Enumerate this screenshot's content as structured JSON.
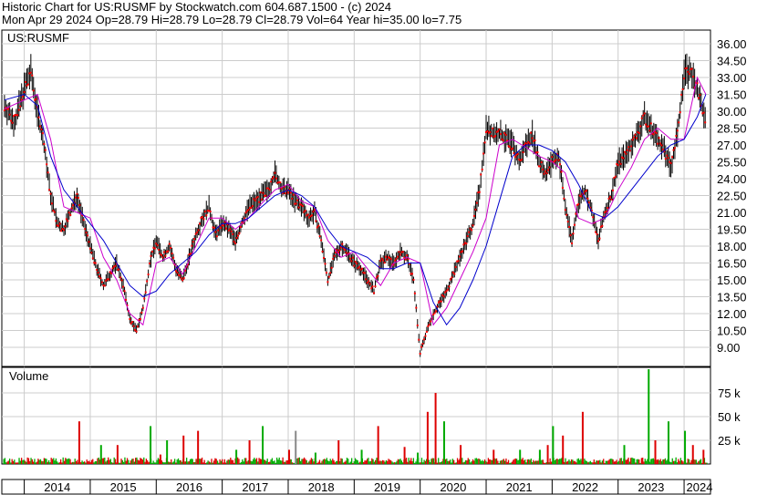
{
  "header": {
    "line1": "Historic Chart for US:RUSMF by Stockwatch.com 604.687.1500 - (c) 2024",
    "line2": "Mon Apr 29 2024   Op=28.79   Hi=28.79   Lo=28.79   Cl=28.79   Vol=64   Year hi=35.00   lo=7.75"
  },
  "colors": {
    "price_bar": "#000000",
    "close_marker": "#ff0000",
    "ma_short": "#cc00cc",
    "ma_long": "#0000cc",
    "volume_up": "#00aa00",
    "volume_down": "#dd0000",
    "volume_flat": "#888888",
    "grid": "#cccccc"
  },
  "chart_data": [
    {
      "type": "line",
      "label": "US:RUSMF",
      "ylim": [
        7.75,
        36.0
      ],
      "y_ticks": [
        "36.00",
        "34.50",
        "33.00",
        "31.50",
        "30.00",
        "28.50",
        "27.00",
        "25.50",
        "24.00",
        "22.50",
        "21.00",
        "19.50",
        "18.00",
        "16.50",
        "15.00",
        "13.50",
        "12.00",
        "10.50",
        "9.00"
      ],
      "x_ticks": [
        "2014",
        "2015",
        "2016",
        "2017",
        "2018",
        "2019",
        "2020",
        "2021",
        "2022",
        "2023",
        "2024"
      ],
      "grid": true,
      "series": [
        {
          "x": [
            2013.7,
            2013.85,
            2014.0,
            2014.1,
            2014.2,
            2014.3,
            2014.4,
            2014.5,
            2014.6,
            2014.7,
            2014.8,
            2014.9,
            2015.0,
            2015.1,
            2015.2,
            2015.3,
            2015.4,
            2015.5,
            2015.6,
            2015.7,
            2015.8,
            2015.9,
            2016.0,
            2016.1,
            2016.2,
            2016.3,
            2016.4,
            2016.5,
            2016.6,
            2016.7,
            2016.8,
            2016.9,
            2017.0,
            2017.1,
            2017.2,
            2017.3,
            2017.4,
            2017.5,
            2017.6,
            2017.7,
            2017.8,
            2017.9,
            2018.0,
            2018.1,
            2018.2,
            2018.3,
            2018.4,
            2018.5,
            2018.6,
            2018.7,
            2018.8,
            2018.9,
            2019.0,
            2019.1,
            2019.2,
            2019.3,
            2019.4,
            2019.5,
            2019.6,
            2019.7,
            2019.8,
            2019.9,
            2020.0,
            2020.1,
            2020.2,
            2020.3,
            2020.4,
            2020.5,
            2020.6,
            2020.7,
            2020.8,
            2020.9,
            2021.0,
            2021.1,
            2021.2,
            2021.3,
            2021.4,
            2021.5,
            2021.6,
            2021.7,
            2021.8,
            2021.9,
            2022.0,
            2022.1,
            2022.2,
            2022.3,
            2022.4,
            2022.5,
            2022.6,
            2022.7,
            2022.8,
            2022.9,
            2023.0,
            2023.1,
            2023.2,
            2023.3,
            2023.4,
            2023.5,
            2023.6,
            2023.7,
            2023.8,
            2023.9,
            2024.0,
            2024.1,
            2024.2,
            2024.33
          ],
          "values": [
            30.5,
            29.0,
            32.0,
            33.5,
            30.0,
            27.0,
            22.5,
            20.0,
            19.5,
            21.0,
            22.5,
            20.0,
            18.0,
            16.0,
            14.5,
            15.5,
            16.5,
            14.5,
            11.5,
            10.5,
            12.5,
            16.5,
            18.5,
            17.0,
            18.0,
            16.0,
            15.0,
            17.0,
            19.0,
            20.5,
            21.5,
            19.0,
            20.0,
            19.5,
            18.5,
            20.0,
            21.5,
            22.0,
            22.5,
            23.0,
            24.5,
            23.0,
            23.0,
            22.0,
            21.5,
            20.5,
            21.0,
            18.5,
            15.0,
            17.0,
            18.0,
            17.5,
            16.5,
            16.0,
            15.0,
            14.0,
            16.5,
            17.0,
            16.5,
            17.5,
            17.0,
            15.0,
            8.5,
            10.5,
            12.0,
            13.0,
            14.0,
            15.5,
            17.0,
            18.5,
            20.0,
            23.0,
            28.5,
            28.0,
            28.0,
            27.5,
            27.0,
            25.5,
            27.0,
            28.0,
            25.5,
            24.5,
            25.5,
            26.0,
            21.5,
            18.5,
            22.0,
            23.0,
            21.0,
            18.5,
            21.0,
            22.5,
            25.5,
            26.0,
            27.0,
            28.0,
            29.5,
            28.5,
            27.5,
            26.5,
            25.0,
            28.0,
            33.5,
            33.5,
            32.0,
            28.8
          ]
        },
        {
          "x": [
            2013.7,
            2014.0,
            2014.2,
            2014.4,
            2014.6,
            2014.8,
            2015.0,
            2015.2,
            2015.4,
            2015.6,
            2015.8,
            2016.0,
            2016.2,
            2016.4,
            2016.6,
            2016.8,
            2017.0,
            2017.2,
            2017.4,
            2017.6,
            2017.8,
            2018.0,
            2018.2,
            2018.4,
            2018.6,
            2018.8,
            2019.0,
            2019.2,
            2019.4,
            2019.6,
            2019.8,
            2020.0,
            2020.2,
            2020.4,
            2020.6,
            2020.8,
            2021.0,
            2021.2,
            2021.4,
            2021.6,
            2021.8,
            2022.0,
            2022.2,
            2022.4,
            2022.6,
            2022.8,
            2023.0,
            2023.2,
            2023.4,
            2023.6,
            2023.8,
            2024.0,
            2024.2,
            2024.33
          ],
          "values": [
            30.2,
            31.0,
            31.5,
            27.5,
            21.5,
            21.0,
            20.5,
            17.0,
            15.0,
            12.0,
            11.0,
            16.5,
            17.0,
            15.5,
            18.0,
            20.5,
            20.5,
            19.5,
            20.5,
            21.8,
            23.0,
            23.5,
            22.0,
            21.5,
            18.5,
            17.0,
            17.5,
            16.0,
            14.5,
            16.5,
            17.0,
            16.5,
            11.0,
            12.5,
            15.0,
            17.5,
            20.5,
            27.0,
            27.5,
            26.8,
            26.0,
            25.5,
            24.5,
            20.5,
            20.0,
            20.5,
            23.0,
            25.0,
            27.5,
            28.5,
            27.5,
            27.5,
            33.0,
            31.5
          ]
        },
        {
          "x": [
            2013.7,
            2014.0,
            2014.2,
            2014.4,
            2014.6,
            2014.8,
            2015.0,
            2015.2,
            2015.4,
            2015.6,
            2015.8,
            2016.0,
            2016.2,
            2016.4,
            2016.6,
            2016.8,
            2017.0,
            2017.2,
            2017.4,
            2017.6,
            2017.8,
            2018.0,
            2018.2,
            2018.4,
            2018.6,
            2018.8,
            2019.0,
            2019.2,
            2019.4,
            2019.6,
            2019.8,
            2020.0,
            2020.2,
            2020.4,
            2020.6,
            2020.8,
            2021.0,
            2021.2,
            2021.4,
            2021.6,
            2021.8,
            2022.0,
            2022.2,
            2022.4,
            2022.6,
            2022.8,
            2023.0,
            2023.2,
            2023.4,
            2023.6,
            2023.8,
            2024.0,
            2024.2,
            2024.33
          ],
          "values": [
            31.0,
            31.5,
            30.5,
            26.0,
            23.0,
            21.5,
            20.0,
            18.5,
            16.5,
            14.5,
            13.5,
            14.0,
            15.5,
            16.5,
            17.5,
            19.0,
            20.0,
            20.0,
            20.5,
            21.5,
            22.5,
            23.0,
            22.5,
            21.5,
            19.5,
            18.0,
            17.5,
            17.0,
            16.0,
            16.0,
            16.5,
            16.5,
            13.0,
            11.0,
            12.5,
            15.0,
            18.0,
            22.0,
            26.0,
            27.0,
            27.0,
            26.5,
            25.5,
            23.5,
            21.0,
            20.5,
            21.5,
            23.0,
            24.5,
            26.0,
            27.0,
            27.5,
            29.5,
            31.5
          ]
        }
      ]
    },
    {
      "type": "bar",
      "title": "Volume",
      "ylim": [
        0,
        100
      ],
      "y_ticks": [
        "75 k",
        "50 k",
        "25 k"
      ],
      "x": [
        2014.82,
        2015.15,
        2015.4,
        2015.9,
        2016.05,
        2016.15,
        2016.4,
        2016.62,
        2017.2,
        2017.4,
        2017.6,
        2018.0,
        2018.1,
        2018.4,
        2018.75,
        2019.1,
        2019.35,
        2019.75,
        2019.95,
        2020.1,
        2020.22,
        2020.35,
        2020.6,
        2021.1,
        2021.5,
        2021.8,
        2021.92,
        2022.0,
        2022.15,
        2022.45,
        2023.08,
        2023.45,
        2023.55,
        2023.75,
        2024.0,
        2024.12,
        2024.28
      ],
      "values": [
        45,
        20,
        20,
        40,
        10,
        25,
        30,
        35,
        15,
        25,
        40,
        15,
        35,
        12,
        25,
        15,
        40,
        18,
        12,
        55,
        75,
        45,
        20,
        15,
        15,
        15,
        20,
        40,
        30,
        55,
        20,
        100,
        25,
        45,
        35,
        20,
        15
      ],
      "directions": [
        "down",
        "up",
        "down",
        "up",
        "down",
        "up",
        "down",
        "down",
        "up",
        "down",
        "up",
        "down",
        "flat",
        "up",
        "down",
        "up",
        "down",
        "down",
        "up",
        "down",
        "down",
        "up",
        "down",
        "down",
        "up",
        "up",
        "down",
        "up",
        "down",
        "down",
        "up",
        "up",
        "down",
        "up",
        "up",
        "down",
        "down"
      ]
    }
  ]
}
